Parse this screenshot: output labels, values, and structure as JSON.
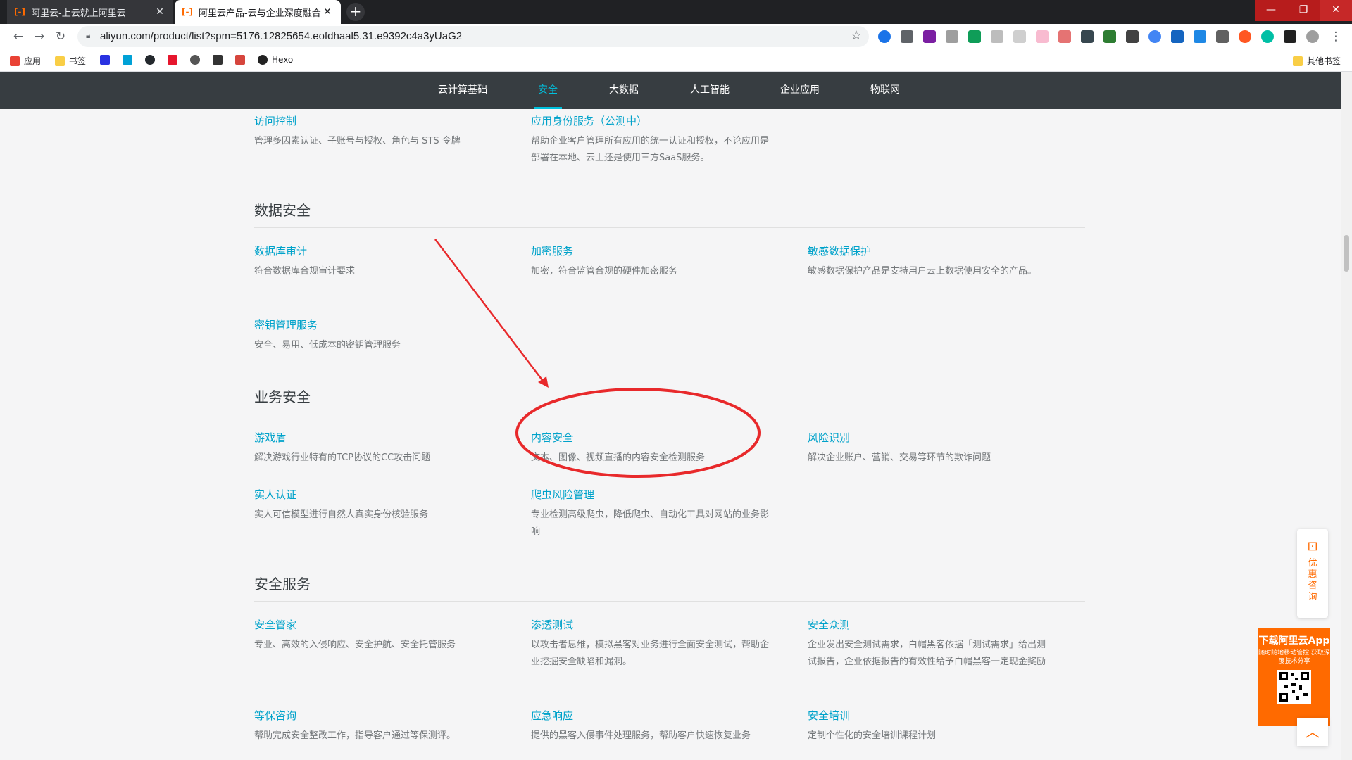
{
  "browser": {
    "tabs": [
      {
        "favicon": "[-]",
        "title": "阿里云-上云就上阿里云",
        "close": "✕"
      },
      {
        "favicon": "[-]",
        "title": "阿里云产品-云与企业深度融合,",
        "close": "✕"
      }
    ],
    "new_tab": "+",
    "window_controls": {
      "min": "—",
      "max": "❐",
      "close": "✕"
    },
    "url": "aliyun.com/product/list?spm=5176.12825654.eofdhaal5.31.e9392c4a3yUaG2",
    "bookmarks": [
      {
        "label": "应用",
        "icon": "apps-grid-icon",
        "color": "#e94235"
      },
      {
        "label": "书签",
        "icon": "folder-icon",
        "color": "#f9ce46"
      },
      {
        "label": "",
        "icon": "baidu-paw-icon",
        "color": "#2932e1"
      },
      {
        "label": "",
        "icon": "bilibili-icon",
        "color": "#00a1d6"
      },
      {
        "label": "",
        "icon": "github-icon",
        "color": "#24292e"
      },
      {
        "label": "",
        "icon": "weibo-icon",
        "color": "#e6162d"
      },
      {
        "label": "",
        "icon": "bookmark-site-icon",
        "color": "#555555"
      },
      {
        "label": "",
        "icon": "bookmark-mask-icon",
        "color": "#333333"
      },
      {
        "label": "",
        "icon": "bookmark-red-icon",
        "color": "#d6453d"
      },
      {
        "label": "Hexo",
        "icon": "hexo-icon",
        "color": "#222222"
      }
    ],
    "other_bookmarks": "其他书签"
  },
  "site_nav": {
    "items": [
      "云计算基础",
      "安全",
      "大数据",
      "人工智能",
      "企业应用",
      "物联网"
    ],
    "active": "安全",
    "accent": "#00c1de"
  },
  "top_products": [
    {
      "title": "访问控制",
      "desc": "管理多因素认证、子账号与授权、角色与 STS 令牌"
    },
    {
      "title": "应用身份服务（公测中）",
      "desc": "帮助企业客户管理所有应用的统一认证和授权，不论应用是部署在本地、云上还是使用三方SaaS服务。"
    }
  ],
  "sections": [
    {
      "title": "数据安全",
      "products": [
        {
          "title": "数据库审计",
          "desc": "符合数据库合规审计要求"
        },
        {
          "title": "加密服务",
          "desc": "加密，符合监管合规的硬件加密服务"
        },
        {
          "title": "敏感数据保护",
          "desc": "敏感数据保护产品是支持用户云上数据使用安全的产品。"
        },
        {
          "title": "密钥管理服务",
          "desc": "安全、易用、低成本的密钥管理服务"
        }
      ]
    },
    {
      "title": "业务安全",
      "products": [
        {
          "title": "游戏盾",
          "desc": "解决游戏行业特有的TCP协议的CC攻击问题"
        },
        {
          "title": "内容安全",
          "desc": "文本、图像、视频直播的内容安全检测服务"
        },
        {
          "title": "风险识别",
          "desc": "解决企业账户、营销、交易等环节的欺诈问题"
        },
        {
          "title": "实人认证",
          "desc": "实人可信模型进行自然人真实身份核验服务"
        },
        {
          "title": "爬虫风险管理",
          "desc": "专业检测高级爬虫，降低爬虫、自动化工具对网站的业务影响"
        }
      ]
    },
    {
      "title": "安全服务",
      "products": [
        {
          "title": "安全管家",
          "desc": "专业、高效的入侵响应、安全护航、安全托管服务"
        },
        {
          "title": "渗透测试",
          "desc": "以攻击者思维，模拟黑客对业务进行全面安全测试，帮助企业挖掘安全缺陷和漏洞。"
        },
        {
          "title": "安全众测",
          "desc": "企业发出安全测试需求，白帽黑客依据「测试需求」给出测试报告，企业依据报告的有效性给予白帽黑客一定现金奖励"
        },
        {
          "title": "等保咨询",
          "desc": "帮助完成安全整改工作，指导客户通过等保测评。"
        },
        {
          "title": "应急响应",
          "desc": "提供的黑客入侵事件处理服务，帮助客户快速恢复业务"
        },
        {
          "title": "安全培训",
          "desc": "定制个性化的安全培训课程计划"
        }
      ]
    }
  ],
  "float": {
    "consult": "优惠咨询",
    "app_title": "下载阿里云App",
    "app_sub": "随时随地移动管控 获取深度技术分享",
    "to_top": "︿"
  },
  "colors": {
    "product_link": "#00a2ca",
    "annotation": "#e8292b",
    "brand": "#ff6a00"
  }
}
